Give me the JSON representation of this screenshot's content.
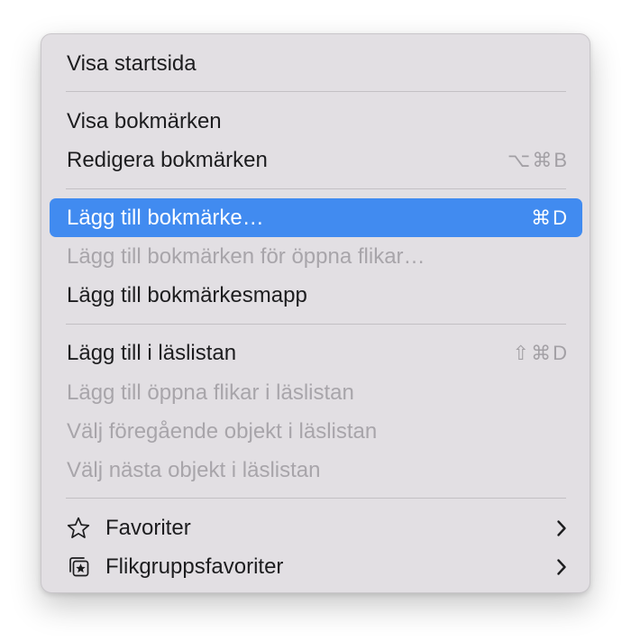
{
  "menu": {
    "items": [
      {
        "label": "Visa startsida"
      },
      {
        "label": "Visa bokmärken"
      },
      {
        "label": "Redigera bokmärken",
        "shortcut": "⌥⌘B"
      },
      {
        "label": "Lägg till bokmärke…",
        "shortcut": "⌘D",
        "state": "highlighted"
      },
      {
        "label": "Lägg till bokmärken för öppna flikar…",
        "state": "disabled"
      },
      {
        "label": "Lägg till bokmärkesmapp"
      },
      {
        "label": "Lägg till i läslistan",
        "shortcut": "⇧⌘D"
      },
      {
        "label": "Lägg till öppna flikar i läslistan",
        "state": "disabled"
      },
      {
        "label": "Välj föregående objekt i läslistan",
        "state": "disabled"
      },
      {
        "label": "Välj nästa objekt i läslistan",
        "state": "disabled"
      },
      {
        "label": "Favoriter",
        "icon": "star-icon",
        "submenu": true
      },
      {
        "label": "Flikgruppsfavoriter",
        "icon": "tab-group-star-icon",
        "submenu": true
      }
    ]
  },
  "colors": {
    "menu_background": "#e2dfe3",
    "highlight": "#418bf0",
    "text": "#1d1d1f",
    "disabled_text": "#a8a5aa"
  }
}
